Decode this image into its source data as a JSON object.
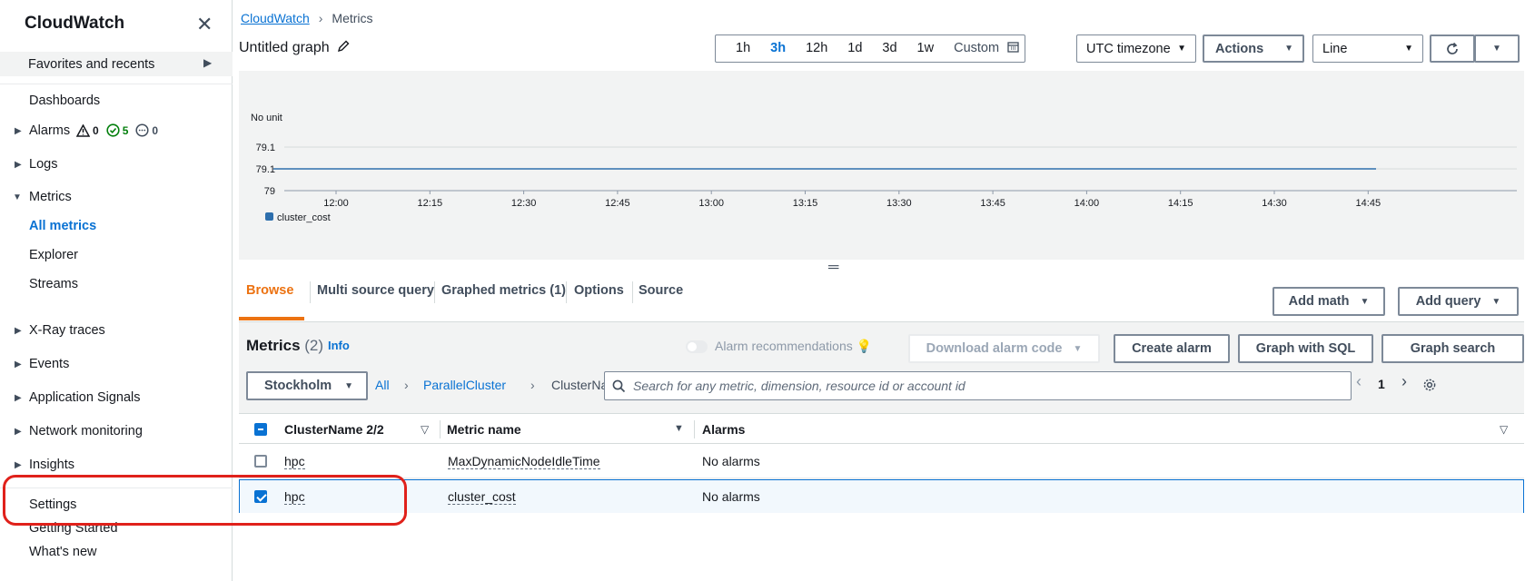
{
  "sidebar": {
    "title": "CloudWatch",
    "favorites": "Favorites and recents",
    "dashboards": "Dashboards",
    "alarms": {
      "label": "Alarms",
      "in_alarm": "0",
      "ok": "5",
      "insufficient": "0"
    },
    "logs": "Logs",
    "metrics": "Metrics",
    "all_metrics": "All metrics",
    "explorer": "Explorer",
    "streams": "Streams",
    "xray": "X-Ray traces",
    "events": "Events",
    "app_signals": "Application Signals",
    "network": "Network monitoring",
    "insights": "Insights",
    "settings": "Settings",
    "getting_started": "Getting Started",
    "whats_new": "What's new"
  },
  "breadcrumb": {
    "root": "CloudWatch",
    "current": "Metrics"
  },
  "graph": {
    "title": "Untitled graph"
  },
  "time_range": {
    "options": [
      "1h",
      "3h",
      "12h",
      "1d",
      "3d",
      "1w"
    ],
    "selected": "3h",
    "custom": "Custom"
  },
  "toolbar": {
    "timezone": "UTC timezone",
    "actions": "Actions",
    "chart_type": "Line"
  },
  "chart_data": {
    "type": "line",
    "ylabel": "No unit",
    "y_ticks": [
      "79.1",
      "79.1",
      "79"
    ],
    "x_ticks": [
      "12:00",
      "12:15",
      "12:30",
      "12:45",
      "13:00",
      "13:15",
      "13:30",
      "13:45",
      "14:00",
      "14:15",
      "14:30",
      "14:45"
    ],
    "series": [
      {
        "name": "cluster_cost",
        "values": [
          79.1,
          79.1,
          79.1,
          79.1,
          79.1,
          79.1,
          79.1,
          79.1,
          79.1,
          79.1,
          79.1,
          79.1
        ],
        "color": "#2e6fad"
      }
    ]
  },
  "tabs": [
    "Browse",
    "Multi source query",
    "Graphed metrics (1)",
    "Options",
    "Source"
  ],
  "buttons": {
    "add_math": "Add math",
    "add_query": "Add query",
    "download_alarm": "Download alarm code",
    "create_alarm": "Create alarm",
    "graph_sql": "Graph with SQL",
    "graph_search": "Graph search"
  },
  "metrics_panel": {
    "title": "Metrics",
    "count": "(2)",
    "info": "Info",
    "alarm_rec": "Alarm recommendations",
    "region": "Stockholm",
    "path": [
      "All",
      "ParallelCluster",
      "ClusterName"
    ],
    "search_placeholder": "Search for any metric, dimension, resource id or account id",
    "page": "1"
  },
  "table": {
    "headers": [
      "ClusterName 2/2",
      "Metric name",
      "Alarms"
    ],
    "rows": [
      {
        "cluster": "hpc",
        "metric": "MaxDynamicNodeIdleTime",
        "alarms": "No alarms",
        "checked": false
      },
      {
        "cluster": "hpc",
        "metric": "cluster_cost",
        "alarms": "No alarms",
        "checked": true
      }
    ]
  },
  "colors": {
    "accent": "#0972d3",
    "tab_active": "#ec7211",
    "highlight": "#e0211b"
  }
}
